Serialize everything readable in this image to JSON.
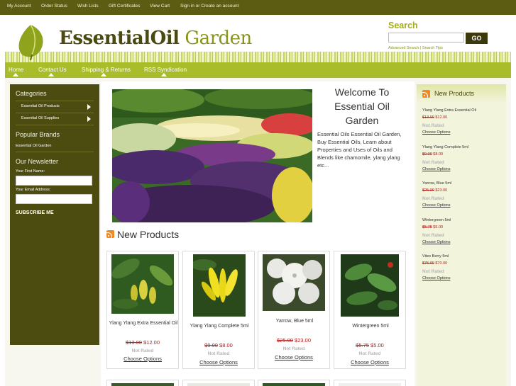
{
  "top_links": [
    "My Account",
    "Order Status",
    "Wish Lists",
    "Gift Certificates",
    "View Cart",
    "Sign in or Create an account"
  ],
  "logo": {
    "part1": "EssentialOil",
    "part2": "Garden"
  },
  "search": {
    "title": "Search",
    "button": "GO",
    "links": "Advanced Search | Search Tips",
    "placeholder": ""
  },
  "nav": [
    "Home",
    "Contact Us",
    "Shipping & Returns",
    "RSS Syndication"
  ],
  "left": {
    "categories_title": "Categories",
    "categories": [
      "Essential Oil Products",
      "Essential Oil Supplies"
    ],
    "brands_title": "Popular Brands",
    "brands": [
      "Essential Oil Garden"
    ],
    "newsletter_title": "Our Newsletter",
    "first_name_label": "Your First Name:",
    "email_label": "Your Email Address:",
    "subscribe": "SUBSCRIBE ME"
  },
  "main": {
    "welcome": "Welcome To Essential Oil Garden",
    "intro": "Essential Oils Essential Oil Garden, Buy Essential Oils, Learn about Properties and Uses of Oils and Blends like chamomile, ylang ylang etc...",
    "new_products_title": "New Products",
    "products": [
      {
        "name": "Ylang Ylang Extra Essential Oil",
        "old": "$13.00",
        "new": "$12.00",
        "rated": "Not Rated",
        "options": "Choose Options"
      },
      {
        "name": "Ylang Ylang Complete 5ml",
        "old": "$9.00",
        "new": "$8.00",
        "rated": "Not Rated",
        "options": "Choose Options"
      },
      {
        "name": "Yarrow, Blue 5ml",
        "old": "$25.00",
        "new": "$23.00",
        "rated": "Not Rated",
        "options": "Choose Options"
      },
      {
        "name": "Wintergreen 5ml",
        "old": "$5.75",
        "new": "$5.00",
        "rated": "Not Rated",
        "options": "Choose Options"
      }
    ]
  },
  "right": {
    "title": "New Products",
    "items": [
      {
        "name": "Ylang Ylang Extra Essential Oil",
        "old": "$13.00",
        "new": "$12.00",
        "rated": "Not Rated",
        "options": "Choose Options"
      },
      {
        "name": "Ylang Ylang Complete 5ml",
        "old": "$9.00",
        "new": "$8.00",
        "rated": "Not Rated",
        "options": "Choose Options"
      },
      {
        "name": "Yarrow, Blue 5ml",
        "old": "$25.00",
        "new": "$23.00",
        "rated": "Not Rated",
        "options": "Choose Options"
      },
      {
        "name": "Wintergreen 5ml",
        "old": "$5.75",
        "new": "$5.00",
        "rated": "Not Rated",
        "options": "Choose Options"
      },
      {
        "name": "Vitex Berry 5ml",
        "old": "$75.00",
        "new": "$70.00",
        "rated": "Not Rated",
        "options": "Choose Options"
      }
    ]
  }
}
